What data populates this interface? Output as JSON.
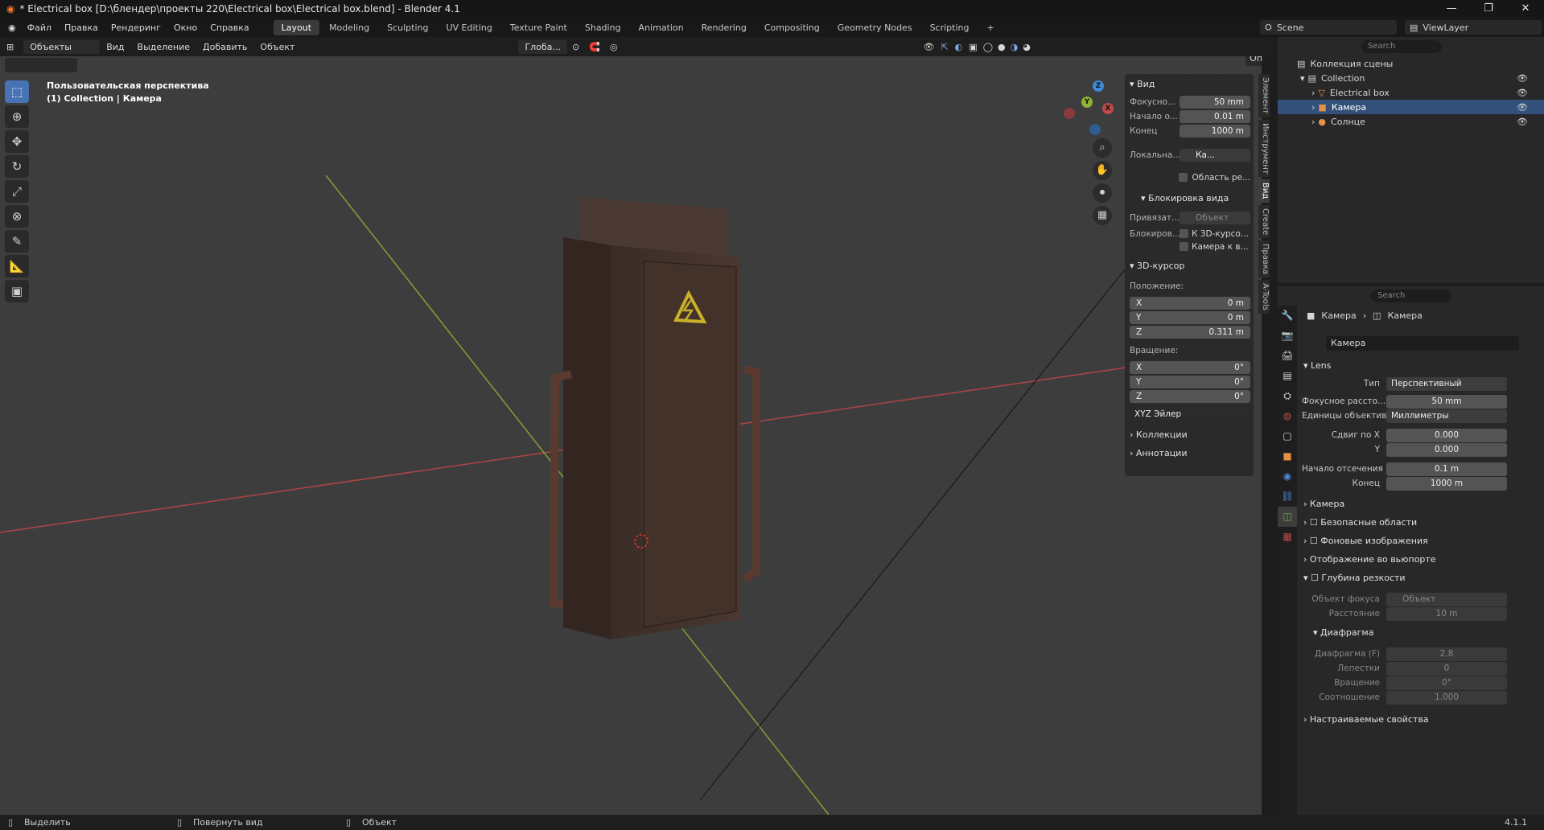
{
  "window": {
    "title": "* Electrical box [D:\\блендер\\проекты 220\\Electrical box\\Electrical box.blend] - Blender 4.1"
  },
  "menu": [
    "Файл",
    "Правка",
    "Рендеринг",
    "Окно",
    "Справка"
  ],
  "workspaces": [
    "Layout",
    "Modeling",
    "Sculpting",
    "UV Editing",
    "Texture Paint",
    "Shading",
    "Animation",
    "Rendering",
    "Compositing",
    "Geometry Nodes",
    "Scripting"
  ],
  "scene": {
    "name": "Scene",
    "viewlayer": "ViewLayer"
  },
  "viewport_header": {
    "mode": "Объекты",
    "items": [
      "Вид",
      "Выделение",
      "Добавить",
      "Объект"
    ],
    "transform": "Глоба...",
    "options": "Опции"
  },
  "overlay": {
    "line1": "Пользовательская перспектива",
    "line2": "(1) Collection | Камера"
  },
  "npanel": {
    "view_header": "Вид",
    "focal_label": "Фокусно...",
    "focal_value": "50 mm",
    "clip_start_label": "Начало о...",
    "clip_start_value": "0.01 m",
    "clip_end_label": "Конец",
    "clip_end_value": "1000 m",
    "local_label": "Локальна...",
    "local_value": "Ка...",
    "render_region": "Область ре...",
    "lock_header": "Блокировка вида",
    "lock_obj_label": "Привязат...",
    "lock_obj_value": "Объект",
    "lock_label": "Блокиров...",
    "lock_cursor": "К 3D-курсо...",
    "lock_camera": "Камера к в...",
    "cursor_header": "3D-курсор",
    "location_label": "Положение:",
    "loc": [
      {
        "axis": "X",
        "value": "0 m"
      },
      {
        "axis": "Y",
        "value": "0 m"
      },
      {
        "axis": "Z",
        "value": "0.311 m"
      }
    ],
    "rotation_label": "Вращение:",
    "rot": [
      {
        "axis": "X",
        "value": "0°"
      },
      {
        "axis": "Y",
        "value": "0°"
      },
      {
        "axis": "Z",
        "value": "0°"
      }
    ],
    "rot_mode": "XYZ Эйлер",
    "collections": "Коллекции",
    "annotations": "Аннотации"
  },
  "side_tabs": [
    "Элемент",
    "Инструмент",
    "Вид",
    "Create",
    "Правка",
    "A-Tools"
  ],
  "outliner": {
    "search_placeholder": "Search",
    "scene_collection": "Коллекция сцены",
    "collection": "Collection",
    "items": [
      "Electrical box",
      "Камера",
      "Солнце"
    ]
  },
  "properties": {
    "search_placeholder": "Search",
    "breadcrumb": [
      "Камера",
      "Камера"
    ],
    "datablock": "Камера",
    "lens_header": "Lens",
    "type_label": "Тип",
    "type_value": "Перспективный",
    "focal_label": "Фокусное рассто...",
    "focal_value": "50 mm",
    "units_label": "Единицы объектива",
    "units_value": "Миллиметры",
    "shiftx_label": "Сдвиг по X",
    "shiftx_value": "0.000",
    "shifty_label": "Y",
    "shifty_value": "0.000",
    "clip_start_label": "Начало отсечения",
    "clip_start_value": "0.1 m",
    "clip_end_label": "Конец",
    "clip_end_value": "1000 m",
    "sections": [
      "Камера",
      "Безопасные области",
      "Фоновые изображения",
      "Отображение во вьюпорте",
      "Глубина резкости"
    ],
    "focus_obj_label": "Объект фокуса",
    "focus_obj_value": "Объект",
    "distance_label": "Расстояние",
    "distance_value": "10 m",
    "aperture_header": "Диафрагма",
    "fstop_label": "Диафрагма (F)",
    "fstop_value": "2.8",
    "blades_label": "Лепестки",
    "blades_value": "0",
    "rotation_label": "Вращение",
    "rotation_value": "0°",
    "ratio_label": "Соотношение",
    "ratio_value": "1.000",
    "custom_props": "Настраиваемые свойства"
  },
  "status": {
    "select": "Выделить",
    "rotate": "Повернуть вид",
    "object": "Объект",
    "version": "4.1.1"
  },
  "colors": {
    "accent": "#4772b3",
    "x_axis": "#c04a4a",
    "y_axis": "#8db531",
    "z_axis": "#3d8ad8"
  }
}
